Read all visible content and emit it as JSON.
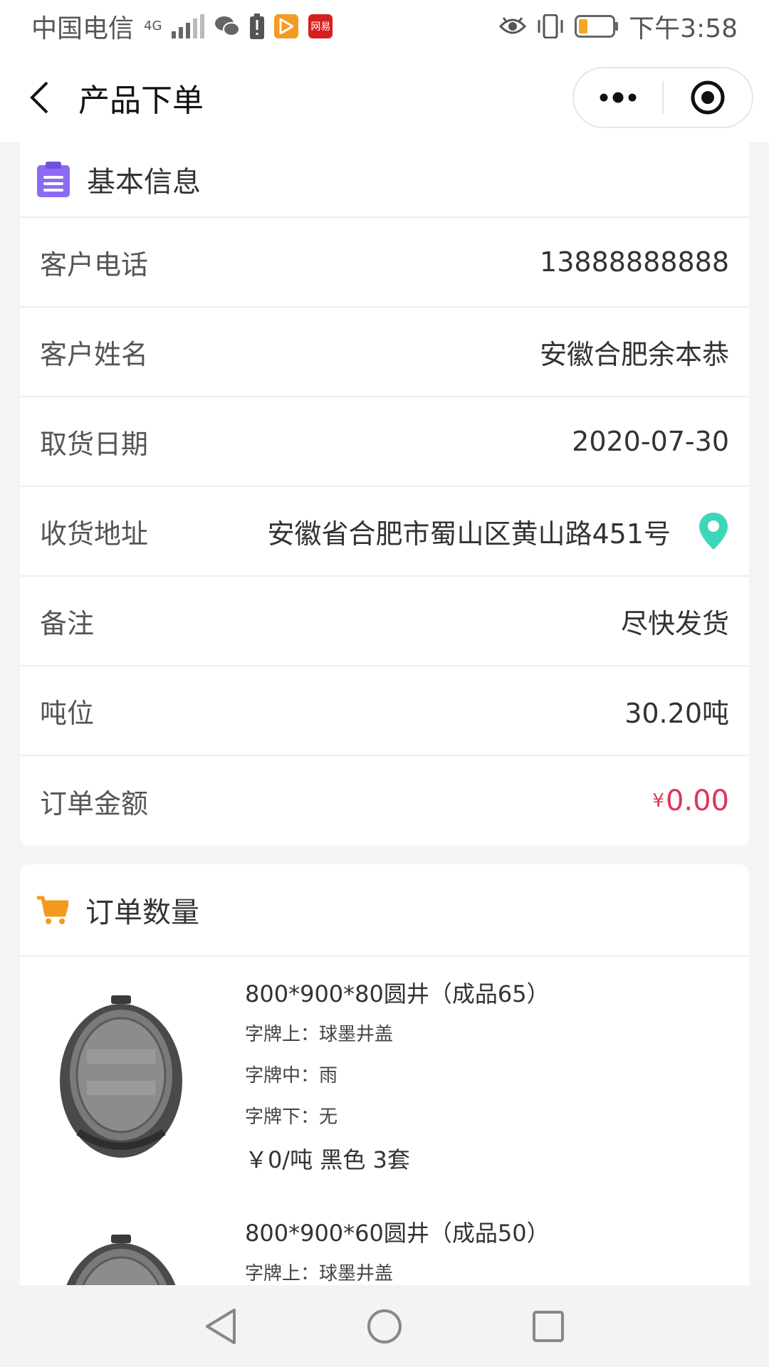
{
  "status_bar": {
    "carrier": "中国电信",
    "network": "4G",
    "time": "下午3:58",
    "app_badge_netease": "网易"
  },
  "nav": {
    "title": "产品下单"
  },
  "basic_info": {
    "header": "基本信息",
    "rows": [
      {
        "label": "客户电话",
        "value": "13888888888"
      },
      {
        "label": "客户姓名",
        "value": "安徽合肥余本恭"
      },
      {
        "label": "取货日期",
        "value": "2020-07-30"
      },
      {
        "label": "收货地址",
        "value": "安徽省合肥市蜀山区黄山路451号"
      },
      {
        "label": "备注",
        "value": "尽快发货"
      },
      {
        "label": "吨位",
        "value": "30.20吨"
      },
      {
        "label": "订单金额",
        "currency": "¥",
        "value": "0.00"
      }
    ]
  },
  "order_qty": {
    "header": "订单数量",
    "products": [
      {
        "name": "800*900*80圆井（成品65）",
        "plate_top": "字牌上：球墨井盖",
        "plate_mid": "字牌中：雨",
        "plate_bottom": "字牌下：无",
        "price_line": "￥0/吨 黑色 3套"
      },
      {
        "name": "800*900*60圆井（成品50）",
        "plate_top": "字牌上：球墨井盖"
      }
    ]
  },
  "colors": {
    "accent_price": "#e0335a",
    "info_icon": "#8b6cf0",
    "location_icon": "#3ed6b8",
    "cart_icon": "#f39a1e"
  }
}
